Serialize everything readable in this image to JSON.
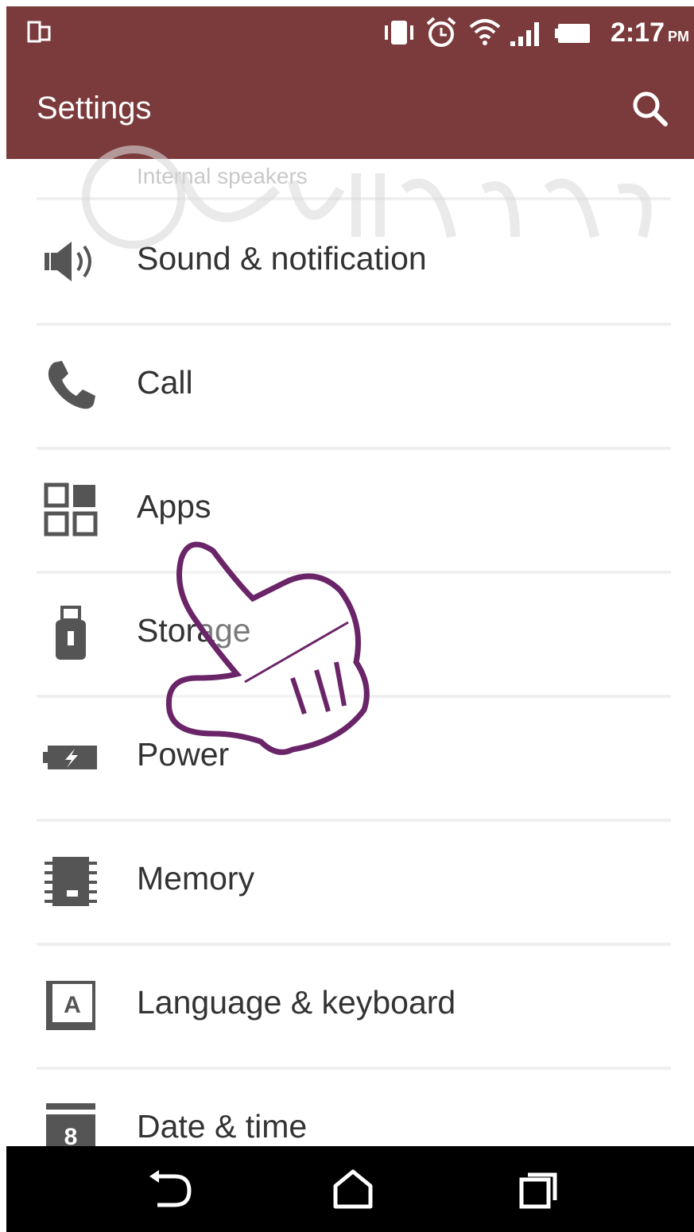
{
  "status_bar": {
    "time": "2:17",
    "ampm": "PM",
    "icons": [
      "sim-icon",
      "vibrate-icon",
      "alarm-icon",
      "wifi-icon",
      "signal-icon",
      "battery-icon"
    ]
  },
  "app_bar": {
    "title": "Settings",
    "search_icon": "search-icon"
  },
  "list": {
    "partial_item": "Internal speakers",
    "items": [
      {
        "label": "Sound & notification",
        "icon": "speaker-icon"
      },
      {
        "label": "Call",
        "icon": "phone-icon"
      },
      {
        "label": "Apps",
        "icon": "apps-grid-icon"
      },
      {
        "label": "Storage",
        "icon": "usb-storage-icon"
      },
      {
        "label": "Power",
        "icon": "battery-charging-icon"
      },
      {
        "label": "Memory",
        "icon": "memory-chip-icon"
      },
      {
        "label": "Language & keyboard",
        "icon": "keyboard-a-icon"
      },
      {
        "label": "Date & time",
        "icon": "calendar-icon"
      }
    ],
    "calendar_day": "8",
    "keyboard_letter": "A"
  },
  "nav_bar": {
    "icons": [
      "back-icon",
      "home-icon",
      "recents-icon"
    ]
  },
  "colors": {
    "accent": "#7b3a3b",
    "divider": "#efefef",
    "text": "#333333",
    "icon": "#555555"
  }
}
